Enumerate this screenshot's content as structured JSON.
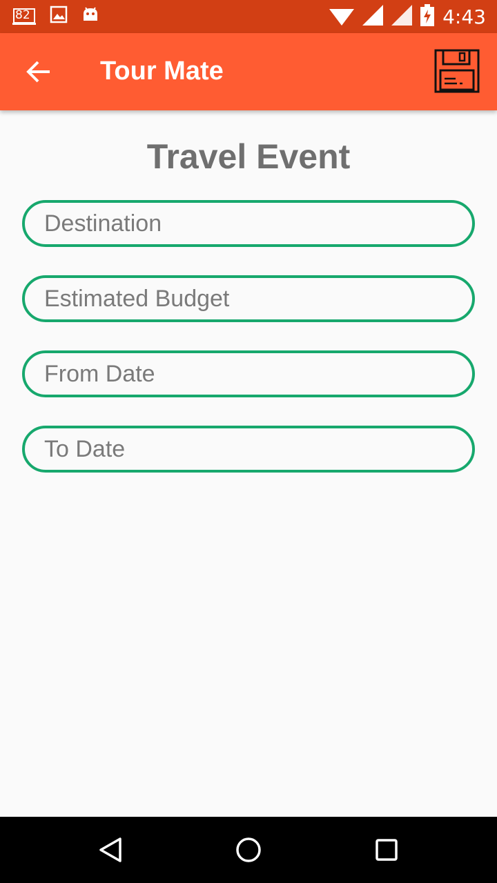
{
  "status_bar": {
    "notification_badge": "82",
    "time": "4:43",
    "icons": [
      "notification-badge-icon",
      "image-icon",
      "android-icon",
      "wifi-icon",
      "signal-icon",
      "signal-icon",
      "battery-charging-icon"
    ]
  },
  "app_bar": {
    "title": "Tour Mate",
    "back_icon": "arrow-back-icon",
    "save_icon": "floppy-disk-icon"
  },
  "form": {
    "heading": "Travel Event",
    "fields": [
      {
        "placeholder": "Destination",
        "value": ""
      },
      {
        "placeholder": "Estimated Budget",
        "value": ""
      },
      {
        "placeholder": "From Date",
        "value": ""
      },
      {
        "placeholder": "To Date",
        "value": ""
      }
    ]
  },
  "nav_bar": {
    "icons": [
      "back-triangle-icon",
      "home-circle-icon",
      "recents-square-icon"
    ]
  },
  "colors": {
    "status_bar": "#d23f14",
    "app_bar": "#ff5c32",
    "field_border": "#17a86d",
    "heading": "#6f6f6f",
    "background": "#fafafa"
  }
}
